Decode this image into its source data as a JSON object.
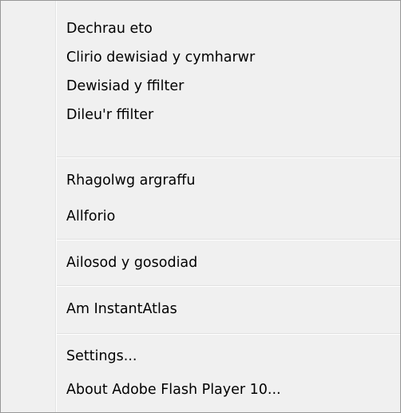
{
  "menu": {
    "groups": [
      {
        "items": [
          {
            "label": "Dechrau eto"
          },
          {
            "label": "Clirio dewisiad y cymharwr"
          },
          {
            "label": "Dewisiad y ffilter"
          },
          {
            "label": "Dileu'r ffilter"
          }
        ]
      },
      {
        "items": [
          {
            "label": "Rhagolwg argraffu"
          },
          {
            "label": "Allforio"
          }
        ]
      },
      {
        "items": [
          {
            "label": "Ailosod y gosodiad"
          }
        ]
      },
      {
        "items": [
          {
            "label": "Am InstantAtlas"
          }
        ]
      },
      {
        "items": [
          {
            "label": "Settings..."
          },
          {
            "label": "About Adobe Flash Player 10..."
          }
        ]
      }
    ]
  }
}
